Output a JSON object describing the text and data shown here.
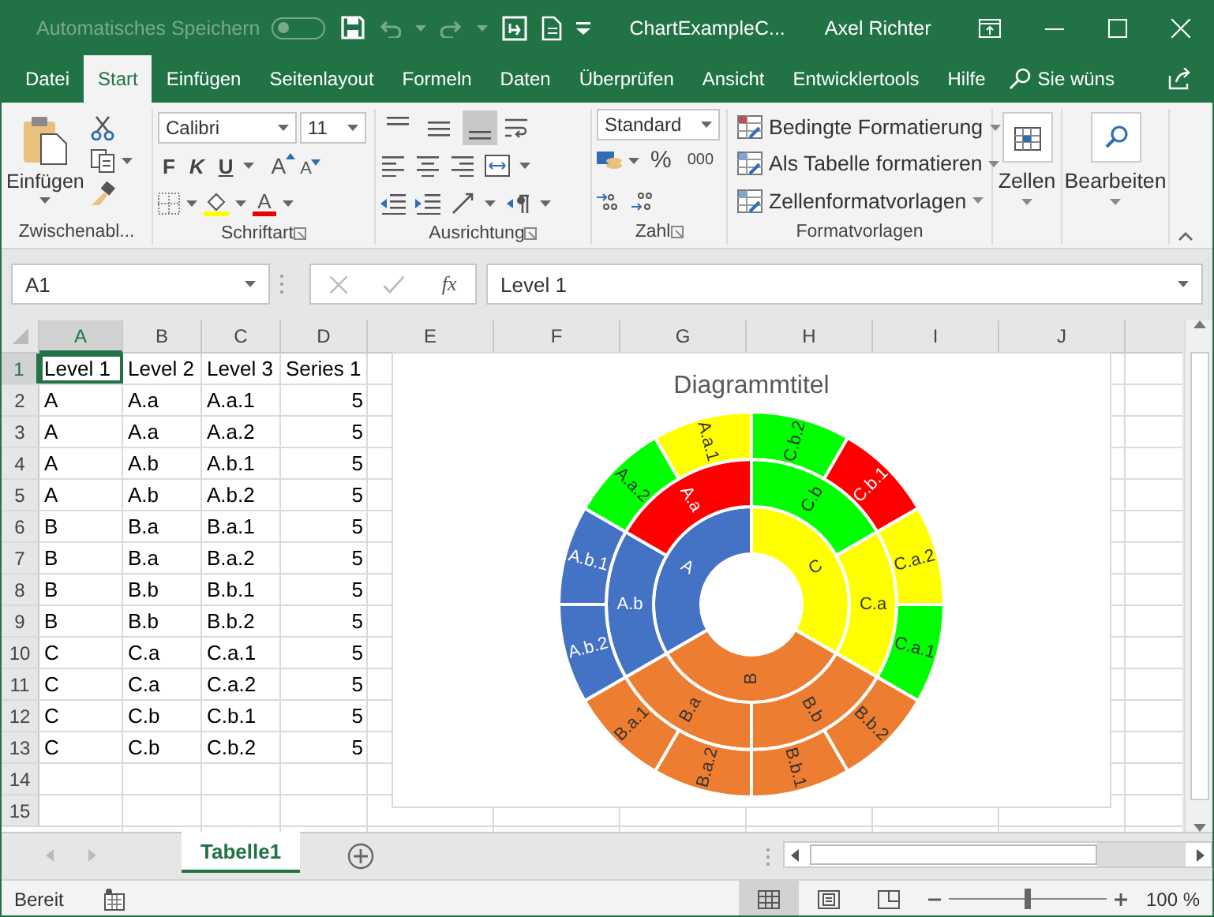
{
  "title_bar": {
    "autosave_label": "Automatisches Speichern",
    "autosave_on": false,
    "file_name": "ChartExampleC...",
    "user": "Axel Richter"
  },
  "menu_tabs": [
    {
      "label": "Datei",
      "selected": false
    },
    {
      "label": "Start",
      "selected": true
    },
    {
      "label": "Einfügen",
      "selected": false
    },
    {
      "label": "Seitenlayout",
      "selected": false
    },
    {
      "label": "Formeln",
      "selected": false
    },
    {
      "label": "Daten",
      "selected": false
    },
    {
      "label": "Überprüfen",
      "selected": false
    },
    {
      "label": "Ansicht",
      "selected": false
    },
    {
      "label": "Entwicklertools",
      "selected": false
    },
    {
      "label": "Hilfe",
      "selected": false
    }
  ],
  "tell_me": "Sie wüns",
  "ribbon": {
    "clipboard": {
      "paste_label": "Einfügen",
      "group_label": "Zwischenabl..."
    },
    "font": {
      "family": "Calibri",
      "size": "11",
      "style_buttons": [
        {
          "label": "F",
          "kind": "bold"
        },
        {
          "label": "K",
          "kind": "italic"
        },
        {
          "label": "U",
          "kind": "underline"
        }
      ],
      "grow_label": "A",
      "shrink_label": "A",
      "color_label": "A",
      "group_label": "Schriftart"
    },
    "alignment": {
      "vertical": [
        {
          "kind": "top",
          "selected": false
        },
        {
          "kind": "middle",
          "selected": false
        },
        {
          "kind": "bottom",
          "selected": true
        }
      ],
      "group_label": "Ausrichtung"
    },
    "number": {
      "format": "Standard",
      "percent": "%",
      "thousands": "000",
      "group_label": "Zahl"
    },
    "styles": {
      "buttons": [
        "Bedingte Formatierung",
        "Als Tabelle formatieren",
        "Zellenformatvorlagen"
      ],
      "group_label": "Formatvorlagen"
    },
    "cells": {
      "label": "Zellen"
    },
    "editing": {
      "label": "Bearbeiten"
    }
  },
  "formula_bar": {
    "name_box": "A1",
    "fx": "fx",
    "formula": "Level 1"
  },
  "sheet": {
    "columns": [
      {
        "label": "A",
        "selected": true
      },
      {
        "label": "B",
        "selected": false
      },
      {
        "label": "C",
        "selected": false
      },
      {
        "label": "D",
        "selected": false
      },
      {
        "label": "E",
        "selected": false
      },
      {
        "label": "F",
        "selected": false
      },
      {
        "label": "G",
        "selected": false
      },
      {
        "label": "H",
        "selected": false
      },
      {
        "label": "I",
        "selected": false
      },
      {
        "label": "J",
        "selected": false
      }
    ],
    "rows": [
      {
        "number": "1",
        "selected": true,
        "cells": [
          {
            "text": "Level 1",
            "kind": "text"
          },
          {
            "text": "Level 2",
            "kind": "text"
          },
          {
            "text": "Level 3",
            "kind": "text"
          },
          {
            "text": "Series 1",
            "kind": "text"
          }
        ]
      },
      {
        "number": "2",
        "selected": false,
        "cells": [
          {
            "text": "A",
            "kind": "text"
          },
          {
            "text": "A.a",
            "kind": "text"
          },
          {
            "text": "A.a.1",
            "kind": "text"
          },
          {
            "text": "5",
            "kind": "number"
          }
        ]
      },
      {
        "number": "3",
        "selected": false,
        "cells": [
          {
            "text": "A",
            "kind": "text"
          },
          {
            "text": "A.a",
            "kind": "text"
          },
          {
            "text": "A.a.2",
            "kind": "text"
          },
          {
            "text": "5",
            "kind": "number"
          }
        ]
      },
      {
        "number": "4",
        "selected": false,
        "cells": [
          {
            "text": "A",
            "kind": "text"
          },
          {
            "text": "A.b",
            "kind": "text"
          },
          {
            "text": "A.b.1",
            "kind": "text"
          },
          {
            "text": "5",
            "kind": "number"
          }
        ]
      },
      {
        "number": "5",
        "selected": false,
        "cells": [
          {
            "text": "A",
            "kind": "text"
          },
          {
            "text": "A.b",
            "kind": "text"
          },
          {
            "text": "A.b.2",
            "kind": "text"
          },
          {
            "text": "5",
            "kind": "number"
          }
        ]
      },
      {
        "number": "6",
        "selected": false,
        "cells": [
          {
            "text": "B",
            "kind": "text"
          },
          {
            "text": "B.a",
            "kind": "text"
          },
          {
            "text": "B.a.1",
            "kind": "text"
          },
          {
            "text": "5",
            "kind": "number"
          }
        ]
      },
      {
        "number": "7",
        "selected": false,
        "cells": [
          {
            "text": "B",
            "kind": "text"
          },
          {
            "text": "B.a",
            "kind": "text"
          },
          {
            "text": "B.a.2",
            "kind": "text"
          },
          {
            "text": "5",
            "kind": "number"
          }
        ]
      },
      {
        "number": "8",
        "selected": false,
        "cells": [
          {
            "text": "B",
            "kind": "text"
          },
          {
            "text": "B.b",
            "kind": "text"
          },
          {
            "text": "B.b.1",
            "kind": "text"
          },
          {
            "text": "5",
            "kind": "number"
          }
        ]
      },
      {
        "number": "9",
        "selected": false,
        "cells": [
          {
            "text": "B",
            "kind": "text"
          },
          {
            "text": "B.b",
            "kind": "text"
          },
          {
            "text": "B.b.2",
            "kind": "text"
          },
          {
            "text": "5",
            "kind": "number"
          }
        ]
      },
      {
        "number": "10",
        "selected": false,
        "cells": [
          {
            "text": "C",
            "kind": "text"
          },
          {
            "text": "C.a",
            "kind": "text"
          },
          {
            "text": "C.a.1",
            "kind": "text"
          },
          {
            "text": "5",
            "kind": "number"
          }
        ]
      },
      {
        "number": "11",
        "selected": false,
        "cells": [
          {
            "text": "C",
            "kind": "text"
          },
          {
            "text": "C.a",
            "kind": "text"
          },
          {
            "text": "C.a.2",
            "kind": "text"
          },
          {
            "text": "5",
            "kind": "number"
          }
        ]
      },
      {
        "number": "12",
        "selected": false,
        "cells": [
          {
            "text": "C",
            "kind": "text"
          },
          {
            "text": "C.b",
            "kind": "text"
          },
          {
            "text": "C.b.1",
            "kind": "text"
          },
          {
            "text": "5",
            "kind": "number"
          }
        ]
      },
      {
        "number": "13",
        "selected": false,
        "cells": [
          {
            "text": "C",
            "kind": "text"
          },
          {
            "text": "C.b",
            "kind": "text"
          },
          {
            "text": "C.b.2",
            "kind": "text"
          },
          {
            "text": "5",
            "kind": "number"
          }
        ]
      },
      {
        "number": "14",
        "selected": false,
        "cells": []
      },
      {
        "number": "15",
        "selected": false,
        "cells": []
      }
    ]
  },
  "chart": {
    "title": "Diagrammtitel",
    "segments": [
      {
        "label": "C",
        "color": "#ffff00",
        "children": [
          {
            "label": "C.b",
            "color": "#00ff00",
            "children": [
              {
                "label": "C.b.2",
                "color": "#00ff00"
              },
              {
                "label": "C.b.1",
                "color": "#ff0000"
              }
            ]
          },
          {
            "label": "C.a",
            "color": "#ffff00",
            "children": [
              {
                "label": "C.a.2",
                "color": "#ffff00"
              },
              {
                "label": "C.a.1",
                "color": "#00ff00"
              }
            ]
          }
        ]
      },
      {
        "label": "B",
        "color": "#ed7d31",
        "children": [
          {
            "label": "B.b",
            "color": "#ed7d31",
            "children": [
              {
                "label": "B.b.2",
                "color": "#ed7d31"
              },
              {
                "label": "B.b.1",
                "color": "#ed7d31"
              }
            ]
          },
          {
            "label": "B.a",
            "color": "#ed7d31",
            "children": [
              {
                "label": "B.a.2",
                "color": "#ed7d31"
              },
              {
                "label": "B.a.1",
                "color": "#ed7d31"
              }
            ]
          }
        ]
      },
      {
        "label": "A",
        "color": "#4472c4",
        "children": [
          {
            "label": "A.b",
            "color": "#4472c4",
            "children": [
              {
                "label": "A.b.2",
                "color": "#4472c4"
              },
              {
                "label": "A.b.1",
                "color": "#4472c4"
              }
            ]
          },
          {
            "label": "A.a",
            "color": "#ff0000",
            "children": [
              {
                "label": "A.a.2",
                "color": "#00ff00"
              },
              {
                "label": "A.a.1",
                "color": "#ffff00"
              }
            ]
          }
        ]
      }
    ]
  },
  "sheet_tabs": [
    {
      "label": "Tabelle1",
      "selected": true
    }
  ],
  "status_bar": {
    "status": "Bereit",
    "views": [
      {
        "kind": "normal",
        "selected": true
      },
      {
        "kind": "page_layout",
        "selected": false
      },
      {
        "kind": "page_break",
        "selected": false
      }
    ],
    "zoom": {
      "level": 0.5
    },
    "zoom_label": "100 %"
  }
}
